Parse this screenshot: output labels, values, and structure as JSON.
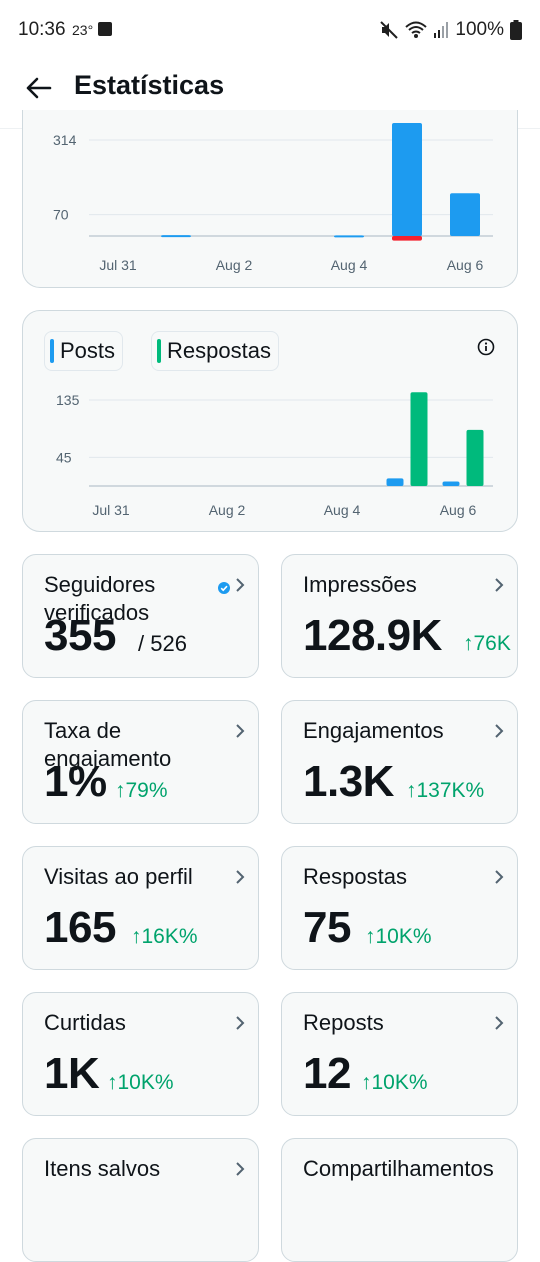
{
  "status_bar": {
    "time": "10:36",
    "temperature": "23°",
    "battery": "100%",
    "icons": [
      "image-icon",
      "mute-icon",
      "wifi-icon",
      "signal-icon",
      "battery-icon"
    ]
  },
  "header": {
    "title": "Estatísticas",
    "back_icon": "arrow-left-icon"
  },
  "colors": {
    "blue": "#1d9bf0",
    "green": "#00ba7c",
    "red": "#f4212e",
    "delta_green": "#00a36c"
  },
  "chart_data": [
    {
      "type": "bar",
      "x_tick_labels": [
        "Jul 31",
        "Aug 2",
        "Aug 4",
        "Aug 6"
      ],
      "y_tick_labels": [
        "314",
        "70"
      ],
      "y_ticks": [
        314,
        70
      ],
      "ylim": [
        -20,
        360
      ],
      "categories": [
        "Jul 31",
        "Aug 1",
        "Aug 2",
        "Aug 3",
        "Aug 4",
        "Aug 5",
        "Aug 6"
      ],
      "series": [
        {
          "color": "#1d9bf0",
          "values": [
            0,
            3,
            0,
            0,
            2,
            370,
            140
          ]
        },
        {
          "color": "#f4212e",
          "values": [
            0,
            0,
            0,
            0,
            0,
            -15,
            0
          ]
        }
      ],
      "grid": true
    },
    {
      "type": "bar",
      "x_tick_labels": [
        "Jul 31",
        "Aug 2",
        "Aug 4",
        "Aug 6"
      ],
      "y_tick_labels": [
        "135",
        "45"
      ],
      "y_ticks": [
        135,
        45
      ],
      "ylim": [
        0,
        160
      ],
      "categories": [
        "Jul 31",
        "Aug 1",
        "Aug 2",
        "Aug 3",
        "Aug 4",
        "Aug 5",
        "Aug 6"
      ],
      "series": [
        {
          "name": "Posts",
          "color": "#1d9bf0",
          "values": [
            0,
            0,
            0,
            0,
            0,
            12,
            7
          ]
        },
        {
          "name": "Respostas",
          "color": "#00ba7c",
          "values": [
            0,
            0,
            0,
            0,
            0,
            147,
            88
          ]
        }
      ],
      "legend": [
        "Posts",
        "Respostas"
      ],
      "grid": true
    }
  ],
  "metrics": [
    {
      "label": "Seguidores verificados",
      "value": "355",
      "sub": "/ 526",
      "verified_icon": "verified-badge-icon"
    },
    {
      "label": "Impressões",
      "value": "128.9K",
      "delta": "↑76K"
    },
    {
      "label": "Taxa de engajamento",
      "value": "1%",
      "delta": "↑79%"
    },
    {
      "label": "Engajamentos",
      "value": "1.3K",
      "delta": "↑137K%"
    },
    {
      "label": "Visitas ao perfil",
      "value": "165",
      "delta": "↑16K%"
    },
    {
      "label": "Respostas",
      "value": "75",
      "delta": "↑10K%"
    },
    {
      "label": "Curtidas",
      "value": "1K",
      "delta": "↑10K%"
    },
    {
      "label": "Reposts",
      "value": "12",
      "delta": "↑10K%"
    },
    {
      "label": "Itens salvos"
    },
    {
      "label": "Compartilhamentos"
    }
  ]
}
